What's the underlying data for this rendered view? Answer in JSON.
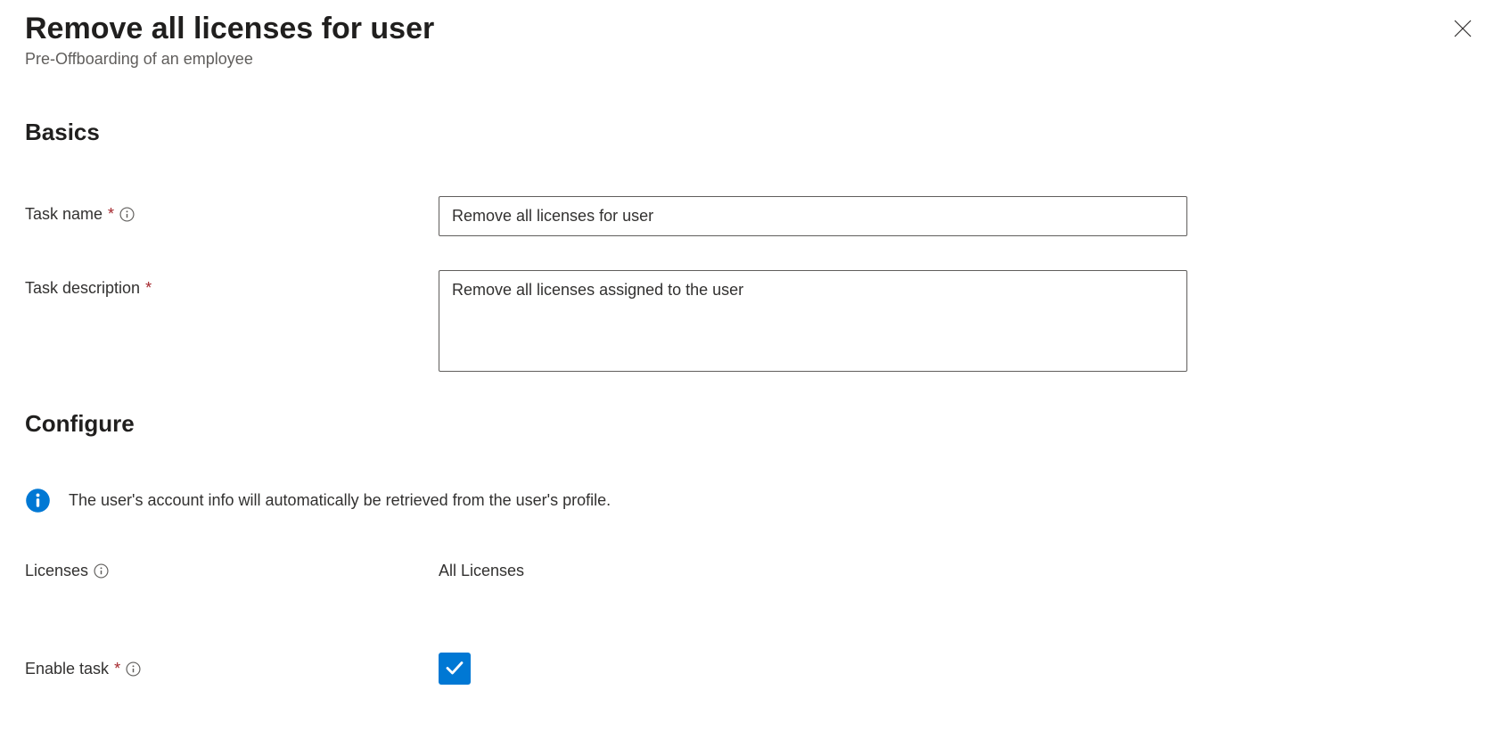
{
  "header": {
    "title": "Remove all licenses for user",
    "subtitle": "Pre-Offboarding of an employee"
  },
  "sections": {
    "basics_heading": "Basics",
    "configure_heading": "Configure"
  },
  "basics": {
    "task_name_label": "Task name",
    "task_name_value": "Remove all licenses for user",
    "task_description_label": "Task description",
    "task_description_value": "Remove all licenses assigned to the user"
  },
  "configure": {
    "info_message": "The user's account info will automatically be retrieved from the user's profile.",
    "licenses_label": "Licenses",
    "licenses_value": "All Licenses",
    "enable_task_label": "Enable task",
    "enable_task_checked": true
  }
}
